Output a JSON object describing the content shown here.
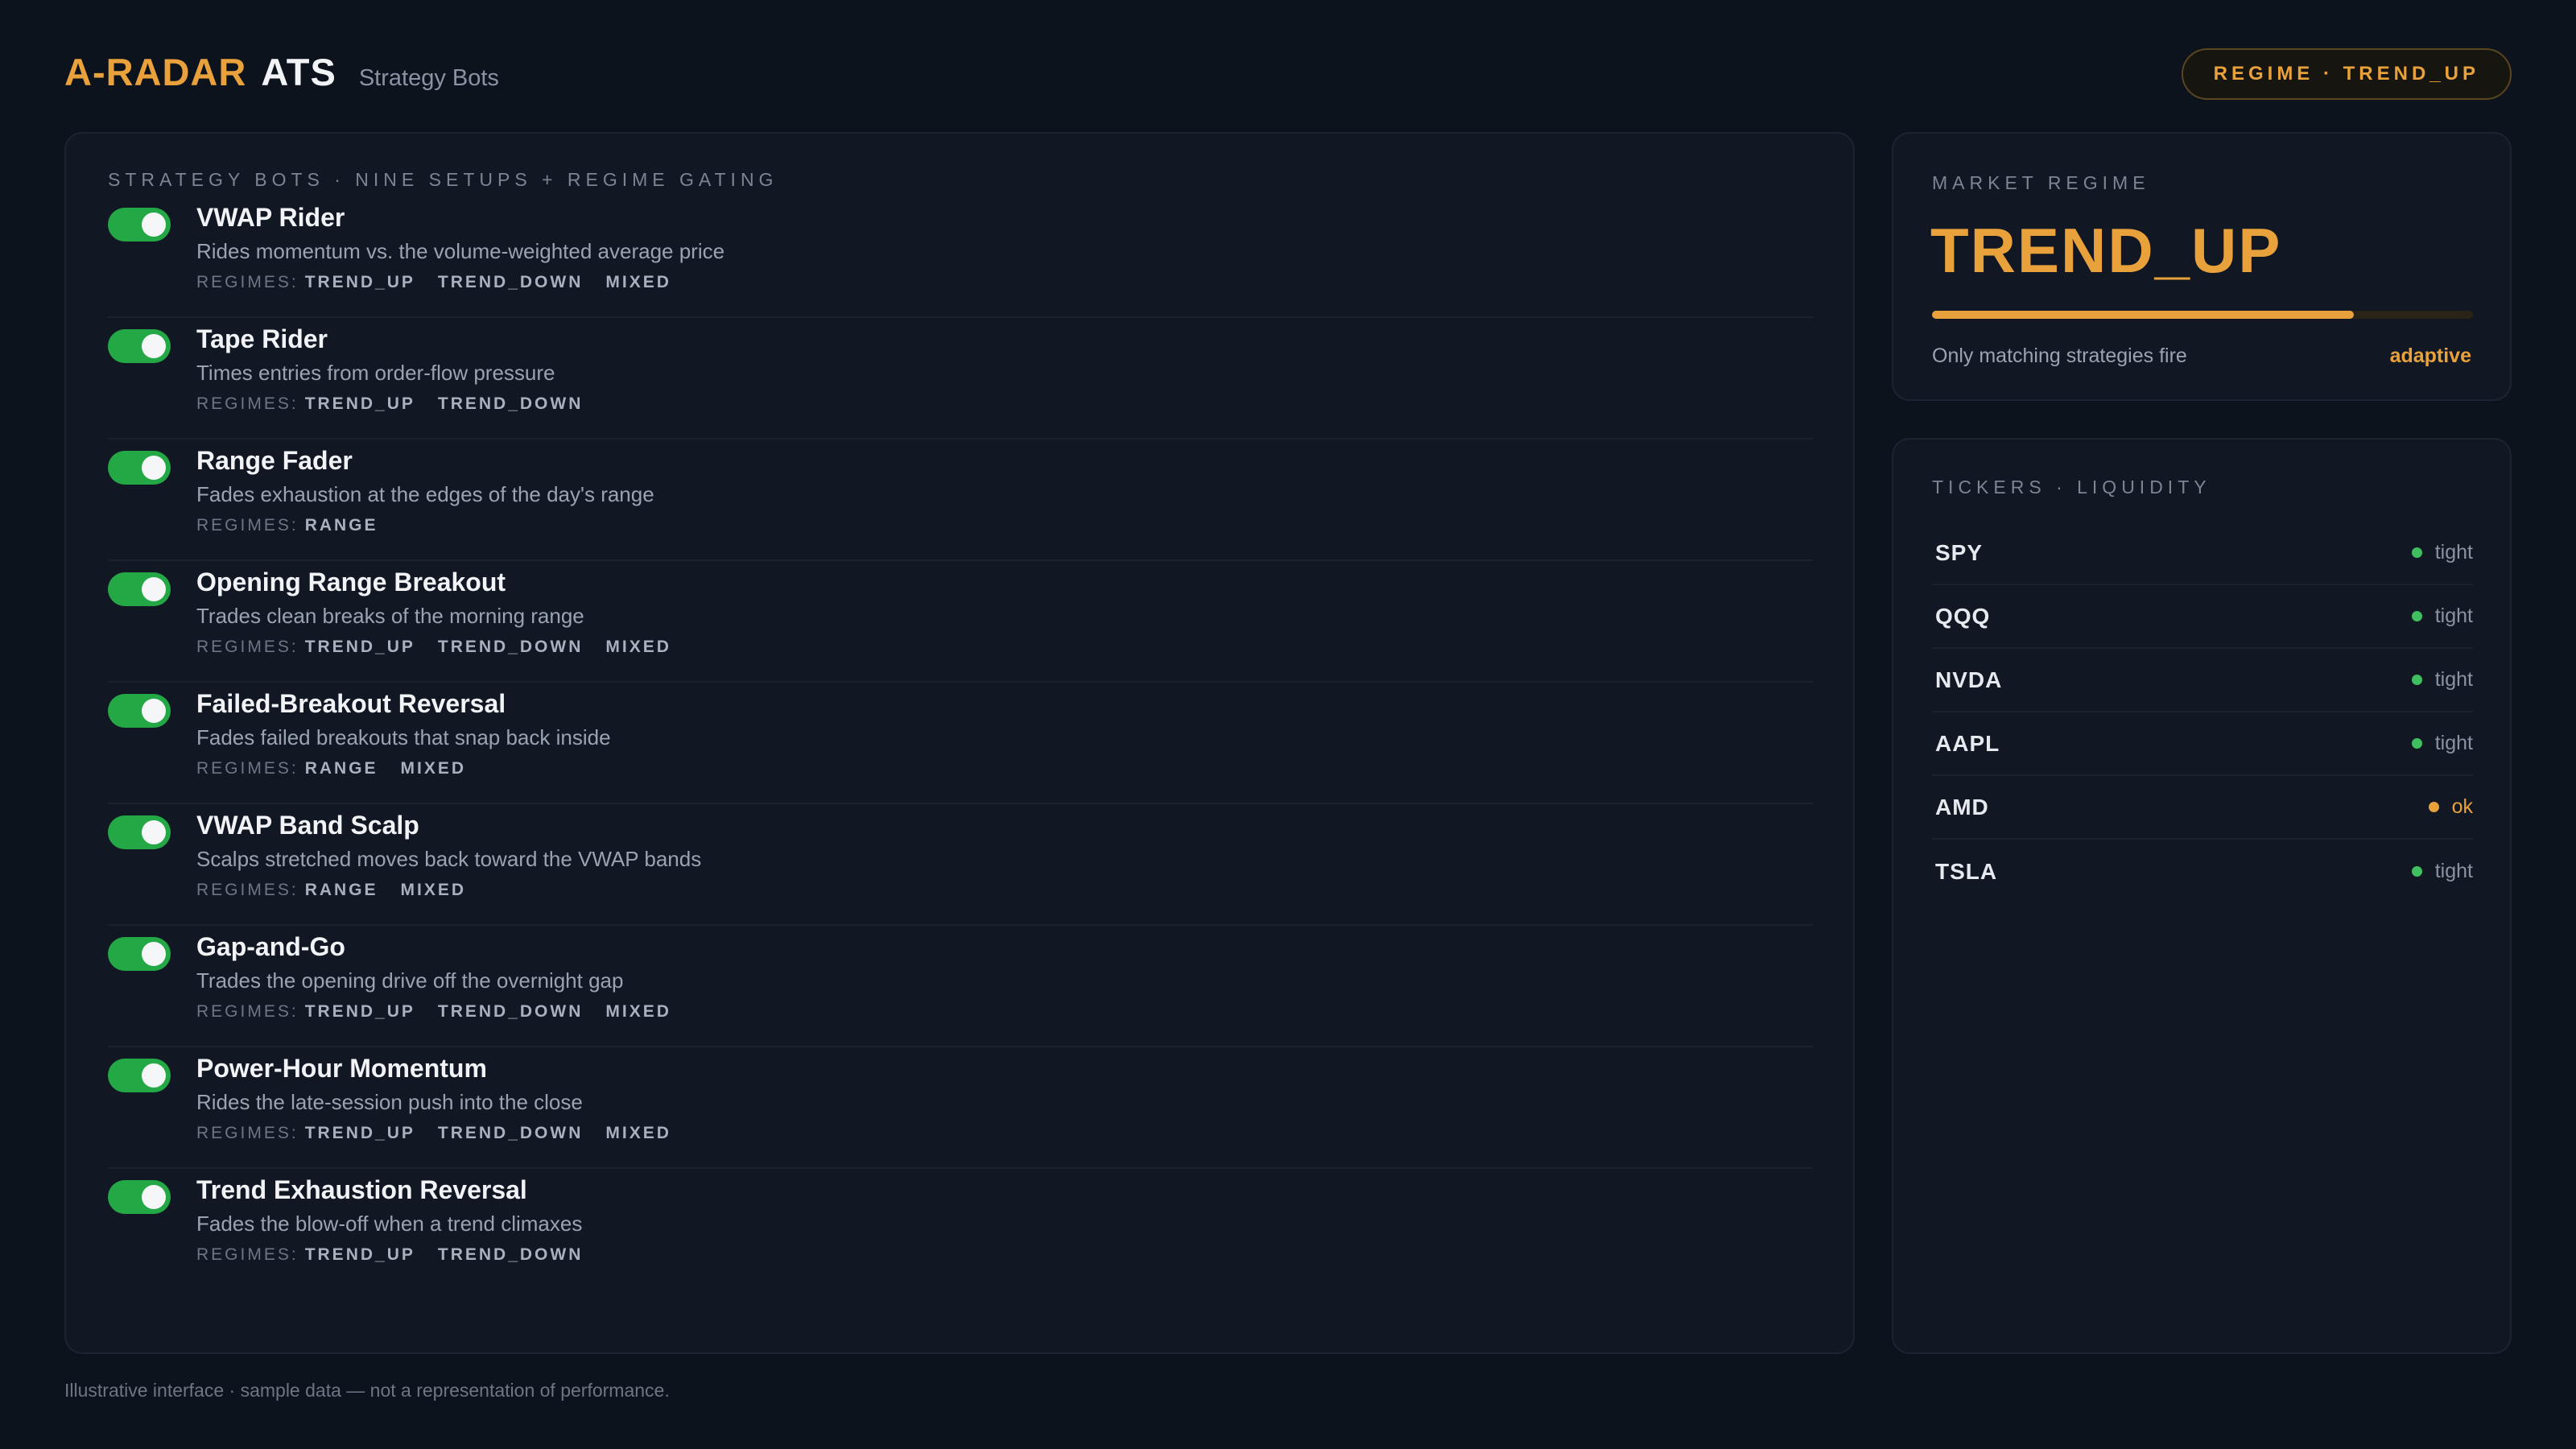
{
  "header": {
    "brand_accent": "A-RADAR",
    "brand_main": "ATS",
    "subtitle": "Strategy Bots",
    "regime_pill": "REGIME · TREND_UP"
  },
  "strategies": {
    "section_label": "STRATEGY BOTS · NINE SETUPS + REGIME GATING",
    "regimes_prefix": "REGIMES:",
    "items": [
      {
        "name": "VWAP Rider",
        "desc": "Rides momentum vs. the volume-weighted average price",
        "enabled": true,
        "regimes": [
          "TREND_UP",
          "TREND_DOWN",
          "MIXED"
        ]
      },
      {
        "name": "Tape Rider",
        "desc": "Times entries from order-flow pressure",
        "enabled": true,
        "regimes": [
          "TREND_UP",
          "TREND_DOWN"
        ]
      },
      {
        "name": "Range Fader",
        "desc": "Fades exhaustion at the edges of the day's range",
        "enabled": true,
        "regimes": [
          "RANGE"
        ]
      },
      {
        "name": "Opening Range Breakout",
        "desc": "Trades clean breaks of the morning range",
        "enabled": true,
        "regimes": [
          "TREND_UP",
          "TREND_DOWN",
          "MIXED"
        ]
      },
      {
        "name": "Failed-Breakout Reversal",
        "desc": "Fades failed breakouts that snap back inside",
        "enabled": true,
        "regimes": [
          "RANGE",
          "MIXED"
        ]
      },
      {
        "name": "VWAP Band Scalp",
        "desc": "Scalps stretched moves back toward the VWAP bands",
        "enabled": true,
        "regimes": [
          "RANGE",
          "MIXED"
        ]
      },
      {
        "name": "Gap-and-Go",
        "desc": "Trades the opening drive off the overnight gap",
        "enabled": true,
        "regimes": [
          "TREND_UP",
          "TREND_DOWN",
          "MIXED"
        ]
      },
      {
        "name": "Power-Hour Momentum",
        "desc": "Rides the late-session push into the close",
        "enabled": true,
        "regimes": [
          "TREND_UP",
          "TREND_DOWN",
          "MIXED"
        ]
      },
      {
        "name": "Trend Exhaustion Reversal",
        "desc": "Fades the blow-off when a trend climaxes",
        "enabled": true,
        "regimes": [
          "TREND_UP",
          "TREND_DOWN"
        ]
      }
    ]
  },
  "market_regime": {
    "label": "MARKET REGIME",
    "value": "TREND_UP",
    "strength": 0.78,
    "note": "Only matching strategies fire",
    "mode": "adaptive"
  },
  "tickers": {
    "label": "TICKERS · LIQUIDITY",
    "items": [
      {
        "symbol": "SPY",
        "status": "tight",
        "color": "#3fbf5f"
      },
      {
        "symbol": "QQQ",
        "status": "tight",
        "color": "#3fbf5f"
      },
      {
        "symbol": "NVDA",
        "status": "tight",
        "color": "#3fbf5f"
      },
      {
        "symbol": "AAPL",
        "status": "tight",
        "color": "#3fbf5f"
      },
      {
        "symbol": "AMD",
        "status": "ok",
        "color": "#e9a23b"
      },
      {
        "symbol": "TSLA",
        "status": "tight",
        "color": "#3fbf5f"
      }
    ]
  },
  "footer": {
    "disclaimer": "Illustrative interface · sample data — not a representation of performance."
  },
  "colors": {
    "accent": "#e9a23b",
    "toggle_on": "#23a845",
    "status_tight": "#3fbf5f",
    "status_ok": "#e9a23b"
  }
}
